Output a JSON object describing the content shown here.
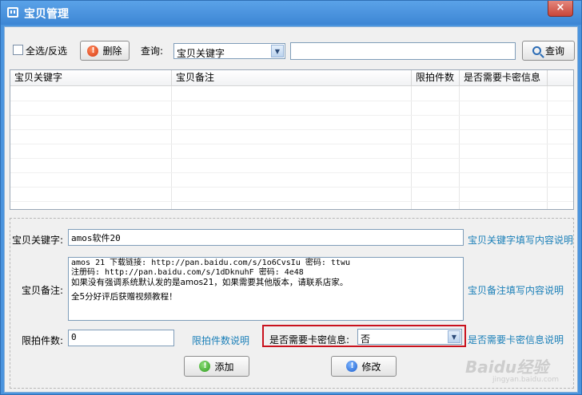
{
  "window": {
    "title": "宝贝管理",
    "close_label": "×"
  },
  "toolbar": {
    "select_all_label": "全选/反选",
    "delete_label": "删除",
    "query_label": "查询:",
    "query_combo_value": "宝贝关键字",
    "search_value": "",
    "search_label": "查询"
  },
  "grid": {
    "columns": [
      "宝贝关键字",
      "宝贝备注",
      "限拍件数",
      "是否需要卡密信息"
    ],
    "rows": []
  },
  "form": {
    "keyword_label": "宝贝关键字:",
    "keyword_value": "amos软件20",
    "keyword_help": "宝贝关键字填写内容说明",
    "note_label": "宝贝备注:",
    "note_lines": [
      "amos 21 下载链接: http://pan.baidu.com/s/1o6CvsIu 密码: ttwu",
      "注册码: http://pan.baidu.com/s/1dDknuhF 密码: 4e48",
      "如果没有强调系统默认发的是amos21，如果需要其他版本，请联系店家。",
      "全5分好评后获赠视频教程！"
    ],
    "note_help": "宝贝备注填写内容说明",
    "limit_label": "限拍件数:",
    "limit_value": "0",
    "limit_help": "限拍件数说明",
    "card_label": "是否需要卡密信息:",
    "card_value": "否",
    "card_help": "是否需要卡密信息说明",
    "add_label": "添加",
    "modify_label": "修改"
  },
  "watermark": {
    "text": "Baidu经验",
    "url": "jingyan.baidu.com"
  },
  "colors": {
    "title_bar": "#4a94de",
    "link": "#1a7fb8",
    "highlight_box": "#c9121d"
  }
}
